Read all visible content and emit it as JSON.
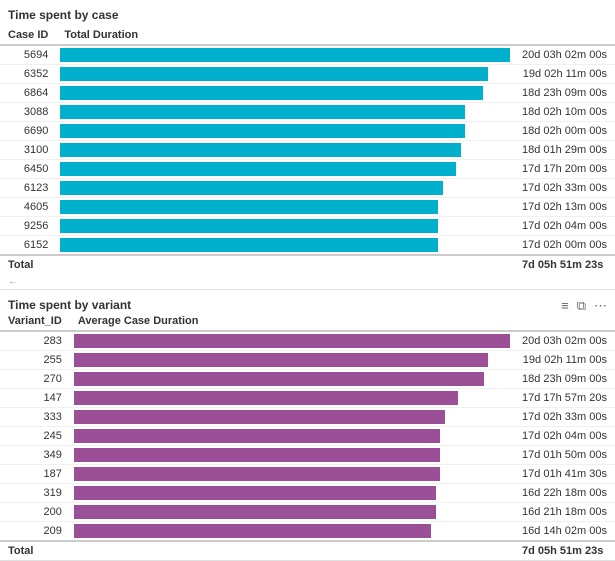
{
  "section1": {
    "title": "Time spent by case",
    "columns": [
      "Case ID",
      "Total Duration"
    ],
    "rows": [
      {
        "id": "5694",
        "duration": "20d 03h 02m 00s",
        "pct": 100
      },
      {
        "id": "6352",
        "duration": "19d 02h 11m 00s",
        "pct": 95
      },
      {
        "id": "6864",
        "duration": "18d 23h 09m 00s",
        "pct": 94
      },
      {
        "id": "3088",
        "duration": "18d 02h 10m 00s",
        "pct": 90
      },
      {
        "id": "6690",
        "duration": "18d 02h 00m 00s",
        "pct": 90
      },
      {
        "id": "3100",
        "duration": "18d 01h 29m 00s",
        "pct": 89
      },
      {
        "id": "6450",
        "duration": "17d 17h 20m 00s",
        "pct": 88
      },
      {
        "id": "6123",
        "duration": "17d 02h 33m 00s",
        "pct": 85
      },
      {
        "id": "4605",
        "duration": "17d 02h 13m 00s",
        "pct": 84
      },
      {
        "id": "9256",
        "duration": "17d 02h 04m 00s",
        "pct": 84
      },
      {
        "id": "6152",
        "duration": "17d 02h 00m 00s",
        "pct": 84
      }
    ],
    "total_label": "Total",
    "total_duration": "7d 05h 51m 23s",
    "bar_color": "#00B0CC"
  },
  "section2": {
    "title": "Time spent by variant",
    "columns": [
      "Variant_ID",
      "Average Case Duration"
    ],
    "rows": [
      {
        "id": "283",
        "duration": "20d 03h 02m 00s",
        "pct": 100
      },
      {
        "id": "255",
        "duration": "19d 02h 11m 00s",
        "pct": 95
      },
      {
        "id": "270",
        "duration": "18d 23h 09m 00s",
        "pct": 94
      },
      {
        "id": "147",
        "duration": "17d 17h 57m 20s",
        "pct": 88
      },
      {
        "id": "333",
        "duration": "17d 02h 33m 00s",
        "pct": 85
      },
      {
        "id": "245",
        "duration": "17d 02h 04m 00s",
        "pct": 84
      },
      {
        "id": "349",
        "duration": "17d 01h 50m 00s",
        "pct": 84
      },
      {
        "id": "187",
        "duration": "17d 01h 41m 30s",
        "pct": 84
      },
      {
        "id": "319",
        "duration": "16d 22h 18m 00s",
        "pct": 83
      },
      {
        "id": "200",
        "duration": "16d 21h 18m 00s",
        "pct": 83
      },
      {
        "id": "209",
        "duration": "16d 14h 02m 00s",
        "pct": 82
      }
    ],
    "total_label": "Total",
    "total_duration": "7d 05h 51m 23s",
    "bar_color": "#9B4F96",
    "icons": {
      "filter": "≡",
      "expand": "⤢",
      "more": "•••"
    }
  }
}
